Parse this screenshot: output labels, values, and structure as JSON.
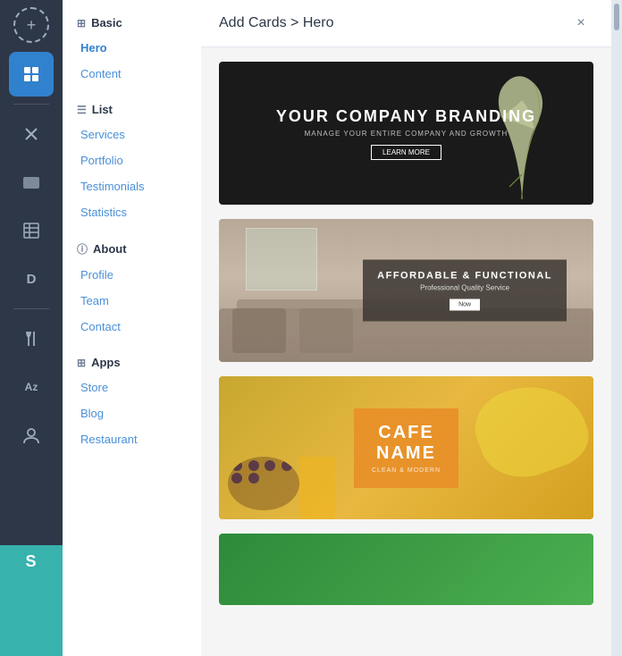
{
  "toolbar": {
    "buttons": [
      {
        "id": "add",
        "icon": "+",
        "label": "add-button",
        "active": false,
        "style": "add"
      },
      {
        "id": "pages",
        "icon": "⊞",
        "label": "pages-button",
        "active": true
      },
      {
        "id": "cross",
        "icon": "✕",
        "label": "cross-button",
        "active": false
      },
      {
        "id": "folder",
        "icon": "▦",
        "label": "folder-button",
        "active": false
      },
      {
        "id": "table",
        "icon": "⊟",
        "label": "table-button",
        "active": false
      },
      {
        "id": "d",
        "icon": "D",
        "label": "d-button",
        "active": false
      },
      {
        "id": "fork",
        "icon": "⚔",
        "label": "fork-button",
        "active": false
      },
      {
        "id": "az",
        "icon": "Az",
        "label": "az-button",
        "active": false
      },
      {
        "id": "person",
        "icon": "⚇",
        "label": "person-button",
        "active": false
      }
    ]
  },
  "sidebar": {
    "sections": [
      {
        "id": "basic",
        "icon": "⊞",
        "label": "Basic",
        "items": [
          {
            "id": "hero",
            "label": "Hero",
            "active": true
          },
          {
            "id": "content",
            "label": "Content",
            "active": false
          }
        ]
      },
      {
        "id": "list",
        "icon": "☰",
        "label": "List",
        "items": [
          {
            "id": "services",
            "label": "Services",
            "active": false
          },
          {
            "id": "portfolio",
            "label": "Portfolio",
            "active": false
          },
          {
            "id": "testimonials",
            "label": "Testimonials",
            "active": false
          },
          {
            "id": "statistics",
            "label": "Statistics",
            "active": false
          }
        ]
      },
      {
        "id": "about",
        "icon": "ⓘ",
        "label": "About",
        "items": [
          {
            "id": "profile",
            "label": "Profile",
            "active": false
          },
          {
            "id": "team",
            "label": "Team",
            "active": false
          },
          {
            "id": "contact",
            "label": "Contact",
            "active": false
          }
        ]
      },
      {
        "id": "apps",
        "icon": "⊞",
        "label": "Apps",
        "items": [
          {
            "id": "store",
            "label": "Store",
            "active": false
          },
          {
            "id": "blog",
            "label": "Blog",
            "active": false
          },
          {
            "id": "restaurant",
            "label": "Restaurant",
            "active": false
          }
        ]
      }
    ]
  },
  "main": {
    "title": "Add Cards > Hero",
    "close_label": "×",
    "cards": [
      {
        "id": "card-1",
        "type": "dark-floral",
        "heading": "YOUR COMPANY BRANDING",
        "subtitle": "MANAGE YOUR ENTIRE COMPANY AND GROWTH",
        "button_label": "LEARN MORE"
      },
      {
        "id": "card-2",
        "type": "interior",
        "heading": "AFFORDABLE & FUNCTIONAL",
        "subtitle": "Professional Quality Service",
        "button_label": "Now"
      },
      {
        "id": "card-3",
        "type": "cafe",
        "cafe_line1": "CAFE",
        "cafe_line2": "NAME",
        "tagline": "CLEAN & MODERN"
      },
      {
        "id": "card-4",
        "type": "green-partial"
      }
    ]
  }
}
